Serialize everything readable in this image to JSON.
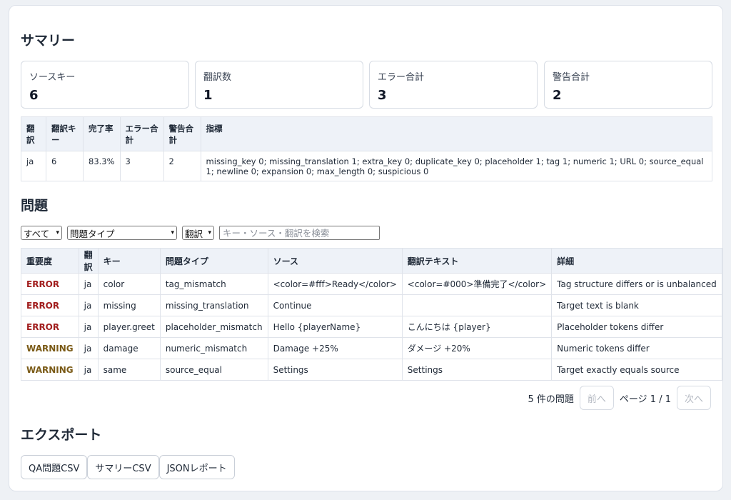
{
  "summary": {
    "heading": "サマリー",
    "stats": [
      {
        "label": "ソースキー",
        "value": "6"
      },
      {
        "label": "翻訳数",
        "value": "1"
      },
      {
        "label": "エラー合計",
        "value": "3"
      },
      {
        "label": "警告合計",
        "value": "2"
      }
    ],
    "table": {
      "headers": [
        "翻訳",
        "翻訳キー",
        "完了率",
        "エラー合計",
        "警告合計",
        "指標"
      ],
      "rows": [
        [
          "ja",
          "6",
          "83.3%",
          "3",
          "2",
          "missing_key 0; missing_translation 1; extra_key 0; duplicate_key 0; placeholder 1; tag 1; numeric 1; URL 0; source_equal 1; newline 0; expansion 0; max_length 0; suspicious 0"
        ]
      ]
    }
  },
  "issues": {
    "heading": "問題",
    "filters": {
      "severity": "すべて",
      "type": "問題タイプ",
      "locale": "翻訳",
      "search_placeholder": "キー・ソース・翻訳を検索"
    },
    "headers": [
      "重要度",
      "翻訳",
      "キー",
      "問題タイプ",
      "ソース",
      "翻訳テキスト",
      "詳細"
    ],
    "rows": [
      [
        "ERROR",
        "ja",
        "color",
        "tag_mismatch",
        "<color=#fff>Ready</color>",
        "<color=#000>準備完了</color>",
        "Tag structure differs or is unbalanced"
      ],
      [
        "ERROR",
        "ja",
        "missing",
        "missing_translation",
        "Continue",
        "",
        "Target text is blank"
      ],
      [
        "ERROR",
        "ja",
        "player.greet",
        "placeholder_mismatch",
        "Hello {playerName}",
        "こんにちは {player}",
        "Placeholder tokens differ"
      ],
      [
        "WARNING",
        "ja",
        "damage",
        "numeric_mismatch",
        "Damage +25%",
        "ダメージ +20%",
        "Numeric tokens differ"
      ],
      [
        "WARNING",
        "ja",
        "same",
        "source_equal",
        "Settings",
        "Settings",
        "Target exactly equals source"
      ]
    ],
    "pager": {
      "count": "5 件の問題",
      "prev": "前へ",
      "page": "ページ 1 / 1",
      "next": "次へ"
    }
  },
  "export": {
    "heading": "エクスポート",
    "buttons": [
      "QA問題CSV",
      "サマリーCSV",
      "JSONレポート"
    ]
  }
}
